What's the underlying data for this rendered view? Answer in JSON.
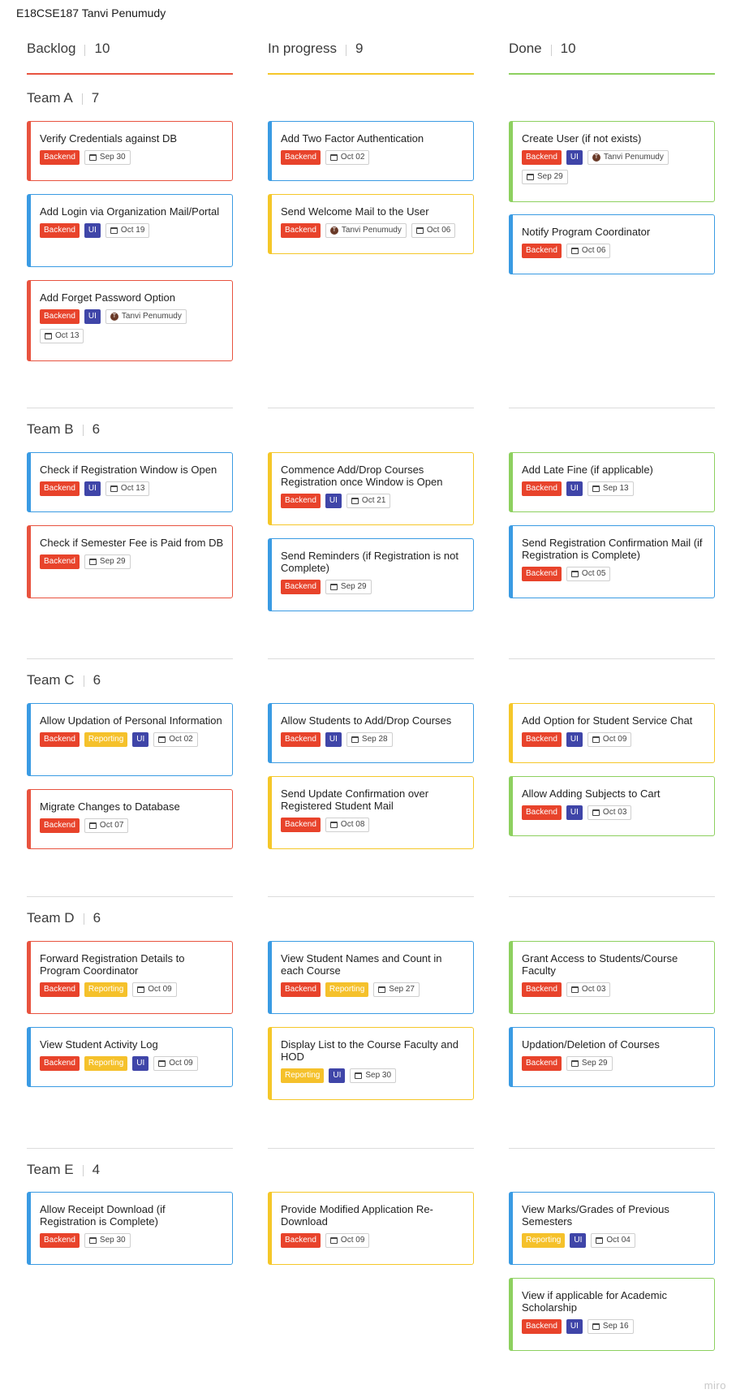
{
  "board": {
    "title": "E18CSE187 Tanvi Penumudy",
    "watermark": "miro"
  },
  "columns": [
    {
      "name": "Backlog",
      "count": "10",
      "color": "#e8533f"
    },
    {
      "name": "In progress",
      "count": "9",
      "color": "#f5c729"
    },
    {
      "name": "Done",
      "count": "10",
      "color": "#8dd05f"
    }
  ],
  "teams": [
    {
      "name": "Team A",
      "count": "7"
    },
    {
      "name": "Team B",
      "count": "6"
    },
    {
      "name": "Team C",
      "count": "6"
    },
    {
      "name": "Team D",
      "count": "6"
    },
    {
      "name": "Team E",
      "count": "4"
    }
  ],
  "tag_labels": {
    "backend": "Backend",
    "ui": "UI",
    "reporting": "Reporting"
  },
  "assignee": {
    "name": "Tanvi Penumudy",
    "initial": "T"
  },
  "cards": [
    {
      "title": "Verify Credentials against DB",
      "color": "red",
      "tags": [
        "backend"
      ],
      "date": "Sep 30"
    },
    {
      "title": "Add Login via Organization Mail/Portal",
      "color": "blue",
      "tags": [
        "backend",
        "ui"
      ],
      "date": "Oct 19"
    },
    {
      "title": "Add Forget Password Option",
      "color": "red",
      "tags": [
        "backend",
        "ui"
      ],
      "assignee": true,
      "date": "Oct 13"
    },
    {
      "title": "Add Two Factor Authentication",
      "color": "blue",
      "tags": [
        "backend"
      ],
      "date": "Oct 02"
    },
    {
      "title": "Send Welcome Mail to the User",
      "color": "yellow",
      "tags": [
        "backend"
      ],
      "assignee": true,
      "date": "Oct 06"
    },
    {
      "title": "Create User (if not exists)",
      "color": "green",
      "tags": [
        "backend",
        "ui"
      ],
      "assignee": true,
      "date": "Sep 29"
    },
    {
      "title": "Notify Program Coordinator",
      "color": "blue",
      "tags": [
        "backend"
      ],
      "date": "Oct 06"
    },
    {
      "title": "Check if Registration Window is Open",
      "color": "blue",
      "tags": [
        "backend",
        "ui"
      ],
      "date": "Oct 13"
    },
    {
      "title": "Check if Semester Fee is Paid from DB",
      "color": "red",
      "tags": [
        "backend"
      ],
      "date": "Sep 29"
    },
    {
      "title": "Commence Add/Drop Courses Registration once Window is Open",
      "color": "yellow",
      "tags": [
        "backend",
        "ui"
      ],
      "date": "Oct 21"
    },
    {
      "title": "Send Reminders (if Registration is not Complete)",
      "color": "blue",
      "tags": [
        "backend"
      ],
      "date": "Sep 29"
    },
    {
      "title": "Add Late Fine (if applicable)",
      "color": "green",
      "tags": [
        "backend",
        "ui"
      ],
      "date": "Sep 13"
    },
    {
      "title": "Send Registration Confirmation Mail (if Registration is Complete)",
      "color": "blue",
      "tags": [
        "backend"
      ],
      "date": "Oct 05"
    },
    {
      "title": "Allow Updation of Personal Information",
      "color": "blue",
      "tags": [
        "backend",
        "reporting",
        "ui"
      ],
      "date": "Oct 02"
    },
    {
      "title": "Migrate Changes to Database",
      "color": "red",
      "tags": [
        "backend"
      ],
      "date": "Oct 07"
    },
    {
      "title": "Allow Students to Add/Drop Courses",
      "color": "blue",
      "tags": [
        "backend",
        "ui"
      ],
      "date": "Sep 28"
    },
    {
      "title": "Send Update Confirmation over Registered Student Mail",
      "color": "yellow",
      "tags": [
        "backend"
      ],
      "date": "Oct 08"
    },
    {
      "title": "Add Option for Student Service Chat",
      "color": "yellow",
      "tags": [
        "backend",
        "ui"
      ],
      "date": "Oct 09"
    },
    {
      "title": "Allow Adding Subjects to Cart",
      "color": "green",
      "tags": [
        "backend",
        "ui"
      ],
      "date": "Oct 03"
    },
    {
      "title": "Forward Registration Details to Program Coordinator",
      "color": "red",
      "tags": [
        "backend",
        "reporting"
      ],
      "date": "Oct 09"
    },
    {
      "title": "View Student Activity Log",
      "color": "blue",
      "tags": [
        "backend",
        "reporting",
        "ui"
      ],
      "date": "Oct 09"
    },
    {
      "title": "View Student Names and Count in each Course",
      "color": "blue",
      "tags": [
        "backend",
        "reporting"
      ],
      "date": "Sep 27"
    },
    {
      "title": "Display List to the Course Faculty and HOD",
      "color": "yellow",
      "tags": [
        "reporting",
        "ui"
      ],
      "date": "Sep 30"
    },
    {
      "title": "Grant Access to Students/Course Faculty",
      "color": "green",
      "tags": [
        "backend"
      ],
      "date": "Oct 03"
    },
    {
      "title": "Updation/Deletion of Courses",
      "color": "blue",
      "tags": [
        "backend"
      ],
      "date": "Sep 29"
    },
    {
      "title": "Allow Receipt Download (if Registration is Complete)",
      "color": "blue",
      "tags": [
        "backend"
      ],
      "date": "Sep 30"
    },
    {
      "title": "Provide Modified Application Re-Download",
      "color": "yellow",
      "tags": [
        "backend"
      ],
      "date": "Oct 09"
    },
    {
      "title": "View Marks/Grades of Previous Semesters",
      "color": "blue",
      "tags": [
        "reporting",
        "ui"
      ],
      "date": "Oct 04"
    },
    {
      "title": "View if applicable for Academic Scholarship",
      "color": "green",
      "tags": [
        "backend",
        "ui"
      ],
      "date": "Sep 16"
    }
  ]
}
